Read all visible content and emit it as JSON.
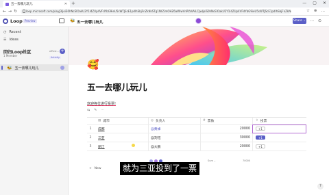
{
  "browser": {
    "tab_title": "五一去哪儿玩儿",
    "new_tab": "+",
    "url": "loop.microsoft.com/p/eyJ3IjoiS0hNcElOakU2Y1l4ZUp4VFdYbG9ieU5sWTJScE1pdlhSbjFnZkNsSTg1NG5mOHZ6aWIwVnRYaVAiLCJwIjoiS0hNcElOakU2Y1l4ZUp4VFdYbG9ieU5sWTJScE1pdlhSbjFnZkNsSTg1NG5mOHZ6aWIw",
    "window_controls": [
      "—",
      "▢",
      "✕"
    ],
    "nav_icons": [
      "←",
      "→",
      "↻"
    ],
    "toolbar_icons": [
      "☆",
      "⊕",
      "…"
    ]
  },
  "app": {
    "name": "Loop",
    "badge": "Preview",
    "breadcrumb": "五一去哪儿玩儿",
    "share_label": "Share ⌄",
    "icons": [
      "⋯",
      "⊙"
    ]
  },
  "sidebar": {
    "items": [
      {
        "icon": "◷",
        "label": "Recent"
      },
      {
        "icon": "☰",
        "label": "Ideas"
      }
    ],
    "workspace_title": "回归Loop社区",
    "workspace_members": "1 Member",
    "workspace_tag": "efficie...",
    "activity": "Activity",
    "pages": [
      {
        "emoji": "🐝",
        "label": "五一去哪儿玩儿"
      }
    ]
  },
  "page": {
    "emoji": "🥰",
    "title": "五一去哪儿玩儿",
    "body": "欢迎各位进行投票!",
    "toolbar": [
      "⇆",
      "✎",
      "⋯"
    ]
  },
  "table": {
    "columns": [
      {
        "icon": "▤",
        "label": "城市"
      },
      {
        "icon": "◎",
        "label": "负责人"
      },
      {
        "icon": "#",
        "label": "票数"
      },
      {
        "icon": "⇧",
        "label": "投票"
      }
    ],
    "rows": [
      {
        "idx": "1",
        "city": "成都",
        "owner": "@黄蜂",
        "votes": "20000",
        "vote_label": "+1",
        "voted": false
      },
      {
        "idx": "2",
        "city": "三亚",
        "owner": "@刘钰",
        "votes": "30000",
        "vote_label": "+1",
        "voted": true
      },
      {
        "idx": "3",
        "city": "丽江",
        "owner": "@大鹏",
        "votes": "20000",
        "vote_label": "+1",
        "voted": false
      }
    ],
    "footer_sum_label": "Sum ⌄",
    "footer_total": "70000",
    "new_row": "New"
  },
  "overlay": {
    "subtitle": "就为三亚投到了一票",
    "help": "?"
  },
  "colors": {
    "accent": "#5b5fc7",
    "selection": "#b36bd4",
    "avatar": "#8d4ad6"
  }
}
